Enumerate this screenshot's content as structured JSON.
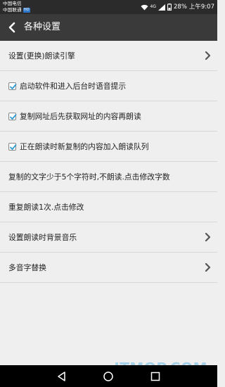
{
  "status_bar": {
    "carrier_line1": "中国电信",
    "carrier_line2": "中国联通",
    "net_badge": "HD",
    "signal_text": "4G",
    "battery_percent": "28%",
    "time": "上午9:07"
  },
  "header": {
    "title": "各种设置",
    "back_icon": "chevron-left-icon"
  },
  "settings": [
    {
      "label": "设置(更换)朗读引擎",
      "type": "link"
    },
    {
      "label": "启动软件和进入后台时语音提示",
      "type": "checkbox",
      "checked": true
    },
    {
      "label": "复制网址后先获取网址的内容再朗读",
      "type": "checkbox",
      "checked": true
    },
    {
      "label": "正在朗读时新复制的内容加入朗读队列",
      "type": "checkbox",
      "checked": true
    },
    {
      "label": "复制的文字少于5个字符时,不朗读.点击修改字数",
      "type": "action"
    },
    {
      "label": "重复朗读1次.点击修改",
      "type": "action"
    },
    {
      "label": "设置朗读时背景音乐",
      "type": "link"
    },
    {
      "label": "多音字替换",
      "type": "link"
    }
  ],
  "colors": {
    "header_bg": "#3a3a3a",
    "list_bg": "#efefef",
    "checkbox_check": "#2e9bd6"
  },
  "watermark": "ITMOP.COM"
}
